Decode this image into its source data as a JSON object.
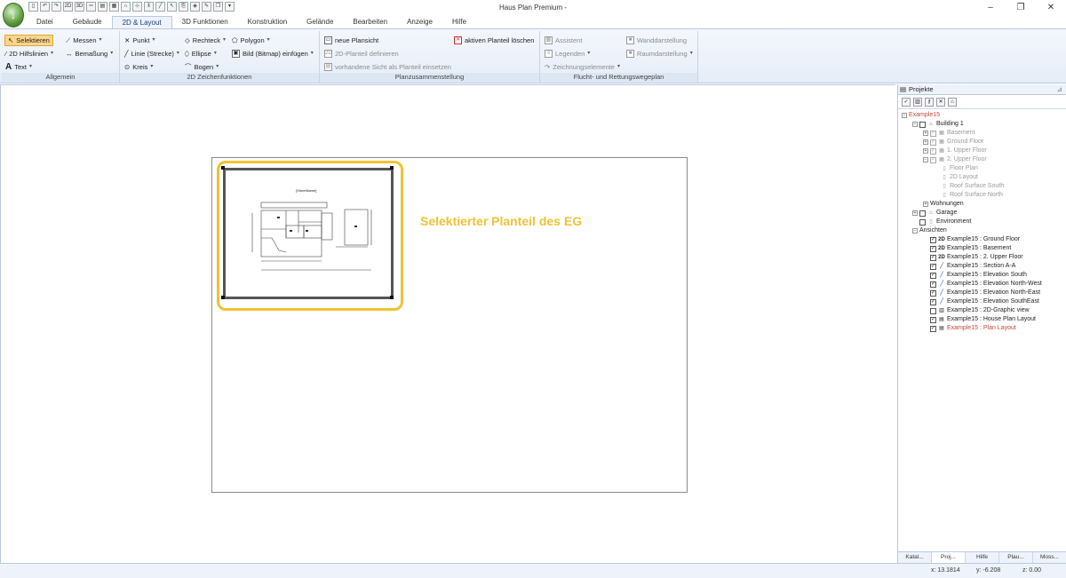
{
  "window": {
    "title": "Haus Plan Premium -",
    "controls": {
      "minimize": "–",
      "restore": "❐",
      "close": "✕"
    }
  },
  "qat": [
    "2D",
    "3D"
  ],
  "tabs": [
    "Datei",
    "Gebäude",
    "2D & Layout",
    "3D Funktionen",
    "Konstruktion",
    "Gelände",
    "Bearbeiten",
    "Anzeige",
    "Hilfe"
  ],
  "active_tab": "2D & Layout",
  "ribbon": {
    "allgemein": {
      "label": "Allgemein",
      "selektieren": "Selektieren",
      "messen": "Messen",
      "hilfslinien": "2D Hilfslinien",
      "bemassung": "Bemaßung",
      "text": "Text"
    },
    "zeichen": {
      "label": "2D Zeichenfunktionen",
      "punkt": "Punkt",
      "rechteck": "Rechteck",
      "polygon": "Polygon",
      "linie": "Linie (Strecke)",
      "ellipse": "Ellipse",
      "bild": "Bild (Bitmap) einfügen",
      "kreis": "Kreis",
      "bogen": "Bogen"
    },
    "planzusammen": {
      "label": "Planzusammenstellung",
      "neue": "neue Plansicht",
      "loeschen": "aktiven Planteil löschen",
      "definieren": "2D-Planteil definieren",
      "einsetzen": "vorhandene Sicht als Planteil einsetzen"
    },
    "flucht": {
      "label": "Flucht- und Rettungswegeplan",
      "assistent": "Assistent",
      "wand": "Wanddarstellung",
      "legenden": "Legenden",
      "raum": "Raumdarstellung",
      "zeichnung": "Zeichnungselemente"
    }
  },
  "canvas": {
    "annotation": "Selektierter Planteil des EG",
    "sheet_title": "[SheetName]"
  },
  "panel": {
    "title": "Projekte",
    "tree": {
      "root": "Example15",
      "building": "Building 1",
      "basement": "Basement",
      "ground": "Ground Floor",
      "upper1": "1. Upper Floor",
      "upper2": "2. Upper Floor",
      "floorplan": "Floor Plan",
      "layout2d": "2D Layout",
      "roofsouth": "Roof Surface South",
      "roofnorth": "Roof Surface North",
      "wohnungen": "Wohnungen",
      "garage": "Garage",
      "environment": "Environment",
      "ansichten": "Ansichten",
      "views": [
        "Example15 : Ground Floor",
        "Example15 : Basement",
        "Example15 : 2. Upper Floor",
        "Example15 : Section A-A",
        "Example15 : Elevation South",
        "Example15 : Elevation North-West",
        "Example15 : Elevation North-East",
        "Example15 : Elevation SouthEast",
        "Example15 : 2D-Graphic view",
        "Example15 : House Plan Layout",
        "Example15 : Plan Layout"
      ]
    },
    "tabs": [
      "Katal...",
      "Proj...",
      "Hilfe",
      "Plau...",
      "Moss..."
    ]
  },
  "status": {
    "x": "x: 13.1814",
    "y": "y: -6.208",
    "z": "z: 0.00"
  }
}
